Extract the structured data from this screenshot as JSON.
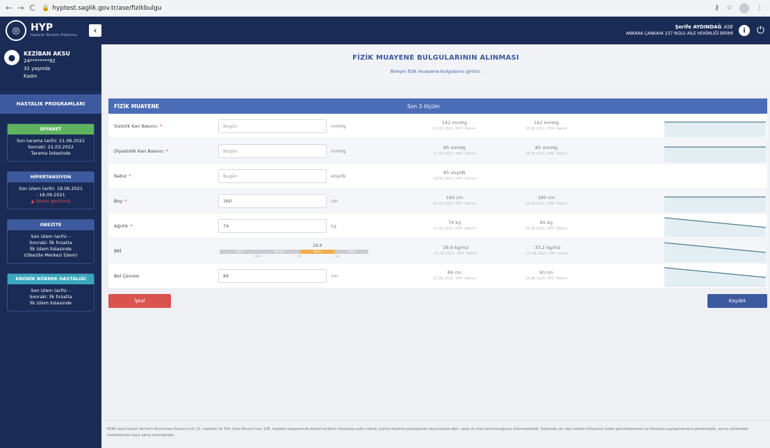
{
  "browser": {
    "url": "hyptest.saglik.gov.tr/ase/fizikbulgu"
  },
  "app": {
    "logo_title": "HYP",
    "logo_subtitle": "Hastalık Yönetim Platformu"
  },
  "user": {
    "name": "Şerife AYDINDAĞ",
    "role": "ASE",
    "unit": "ANKARA ÇANKAYA 237 NOLU AİLE HEKİMLİĞİ BİRİMİ"
  },
  "patient": {
    "name": "KEZİBAN AKSU",
    "id": "24********92",
    "age": "31 yaşında",
    "gender": "Kadın"
  },
  "sidebar": {
    "header": "HASTALIK PROGRAMLARI",
    "programs": [
      {
        "title": "DİYABET",
        "color": "#5fb35f",
        "lines": [
          "Son tarama tarihi: 21.06.2021",
          "Sonraki: 21.03.2022",
          "Tarama listesinde"
        ]
      },
      {
        "title": "HİPERTANSİYON",
        "color": "#3d5a9e",
        "lines": [
          "Son izlem tarihi: 18.06.2021",
          ": 18.09.2021"
        ],
        "warning": "İzlemi gecikmiş"
      },
      {
        "title": "OBEZİTE",
        "color": "#3d5a9e",
        "lines": [
          "Son izlem tarihi: -",
          "Sonraki: İlk fırsatta",
          "İlk izlem listesinde",
          "(Obezite Merkezi İzlem)"
        ]
      },
      {
        "title": "KRONİK BÖBREK HASTALIĞI",
        "color": "#3aa7bd",
        "lines": [
          "Son izlem tarihi: -",
          "Sonraki: İlk fırsatta",
          "İlk izlem listesinde"
        ]
      }
    ]
  },
  "page": {
    "title": "FİZİK MUAYENE BULGULARININ ALINMASI",
    "subtitle": "Bireyin fizik muayene bulgularını giriniz."
  },
  "panel": {
    "title": "FİZİK MUAYENE",
    "history_title": "Son 3 ölçüm"
  },
  "rows": [
    {
      "label": "Sistolik Kan Basıncı",
      "required": true,
      "value": "",
      "placeholder": "Bugün",
      "unit": "mmHg",
      "h1": "142 mmHg",
      "h1d": "21.06.2021, HYP: Hekim",
      "h2": "142 mmHg",
      "h2d": "18.06.2021, HYP: Hekim",
      "trend": [
        142,
        142
      ]
    },
    {
      "label": "Diyastolik Kan Basıncı",
      "required": true,
      "value": "",
      "placeholder": "Bugün",
      "unit": "mmHg",
      "h1": "85 mmHg",
      "h1d": "21.06.2021, HYP: Hekim",
      "h2": "85 mmHg",
      "h2d": "18.06.2021, HYP: Hekim",
      "trend": [
        85,
        85
      ]
    },
    {
      "label": "Nabız",
      "required": true,
      "value": "",
      "placeholder": "Bugün",
      "unit": "atış/dk",
      "h1": "85 atış/dk",
      "h1d": "18.06.2021, HYP: Hekim",
      "h2": "",
      "h2d": "",
      "trend": []
    },
    {
      "label": "Boy",
      "required": true,
      "value": "160",
      "placeholder": "",
      "unit": "cm",
      "h1": "160 cm",
      "h1d": "21.06.2021, HYP: Hekim",
      "h2": "160 cm",
      "h2d": "18.06.2021, HYP: Hekim",
      "trend": [
        160,
        160
      ]
    },
    {
      "label": "Ağırlık",
      "required": true,
      "value": "74",
      "placeholder": "",
      "unit": "kg",
      "h1": "74 kg",
      "h1d": "21.06.2021, HYP: Hekim",
      "h2": "85 kg",
      "h2d": "18.06.2021, HYP: Hekim",
      "trend": [
        85,
        74
      ]
    },
    {
      "label": "BKİ",
      "required": false,
      "bki": true,
      "bki_value": "28.9",
      "bki_segments": [
        "Zayıf",
        "Normal",
        "Kilolu",
        "Obez"
      ],
      "bki_ticks": [
        "18.5",
        "25",
        "30"
      ],
      "h1": "28.9 kg/m2",
      "h1d": "21.06.2021, HYP: Hekim",
      "h2": "33.2 kg/m2",
      "h2d": "18.06.2021, HYP: Hekim",
      "trend": [
        33.2,
        28.9
      ]
    },
    {
      "label": "Bel Çevresi",
      "required": false,
      "value": "84",
      "placeholder": "",
      "unit": "cm",
      "h1": "84 cm",
      "h1d": "21.06.2021, HYP: Hekim",
      "h2": "90 cm",
      "h2d": "18.06.2021, HYP: Hekim",
      "trend": [
        90,
        84
      ]
    }
  ],
  "buttons": {
    "cancel": "İptal",
    "save": "Kaydet"
  },
  "footer": "6698 sayılı Kişisel Verilerin Korunması Kanunu'nun 12. maddesi ile Türk Ceza Kanunu'nun 136. maddesi kapsamında kişisel verilerin mevzuata aykırı olarak üçüncü kişilerle paylaşılması durumunda idari, cezai ve mali sorumluluğunuz bulunmaktadır. Sistemde yer alan verileri ihtiyacınız kadar görüntülemeniz ve kimseyle paylaşmamanız gerekmekte, ayrıca sistemdeki hareketleriniz kayıt altına alınmaktadır."
}
